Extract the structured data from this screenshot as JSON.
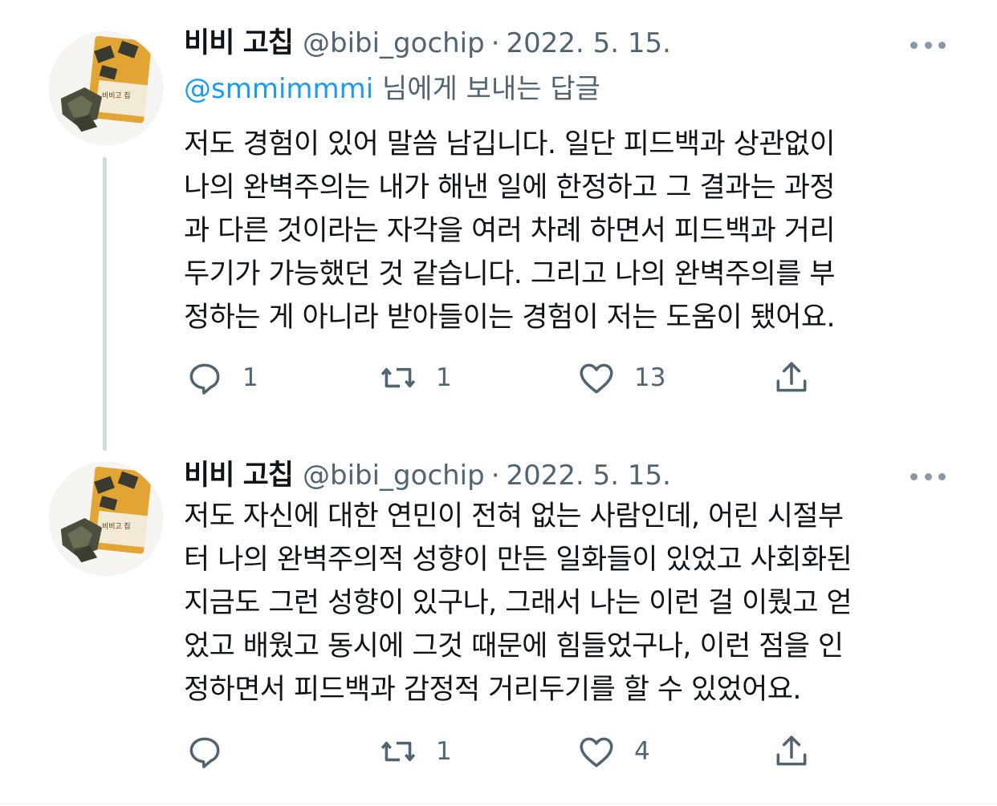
{
  "tweets": [
    {
      "display_name": "비비 고칩",
      "handle": "@bibi_gochip",
      "separator": "·",
      "date": "2022. 5. 15.",
      "reply_mention": "@smmimmmi",
      "reply_suffix": " 님에게 보내는 답글",
      "text_lines": [
        "저도 경험이 있어 말씀 남깁니다. 일단 피드백과 상관없이",
        "나의 완벽주의는 내가 해낸 일에 한정하고 그 결과는 과정",
        "과 다른 것이라는 자각을 여러 차례 하면서 피드백과 거리",
        "두기가 가능했던 것 같습니다. 그리고 나의 완벽주의를 부",
        "정하는 게 아니라 받아들이는 경험이 저는 도움이 됐어요."
      ],
      "reply_count": "1",
      "retweet_count": "1",
      "like_count": "13"
    },
    {
      "display_name": "비비 고칩",
      "handle": "@bibi_gochip",
      "separator": "·",
      "date": "2022. 5. 15.",
      "text_lines": [
        "저도 자신에 대한 연민이 전혀 없는 사람인데, 어린 시절부",
        "터 나의 완벽주의적 성향이 만든 일화들이 있었고 사회화된",
        "지금도 그런 성향이 있구나, 그래서 나는 이런 걸 이뤘고 얻",
        "었고 배웠고 동시에 그것 때문에 힘들었구나, 이런 점을 인",
        "정하면서 피드백과 감정적 거리두기를 할 수 있었어요."
      ],
      "reply_count": "",
      "retweet_count": "1",
      "like_count": "4"
    }
  ],
  "avatar": {
    "label": "비비고 칩"
  },
  "icons": {
    "reply": "speech-bubble-icon",
    "retweet": "retweet-arrows-icon",
    "like": "heart-icon",
    "share": "share-upload-icon",
    "more": "more-dots-icon"
  },
  "colors": {
    "text": "#0f1419",
    "secondary": "#536471",
    "link": "#1d9bf0",
    "thread_line": "#cfd9de"
  }
}
